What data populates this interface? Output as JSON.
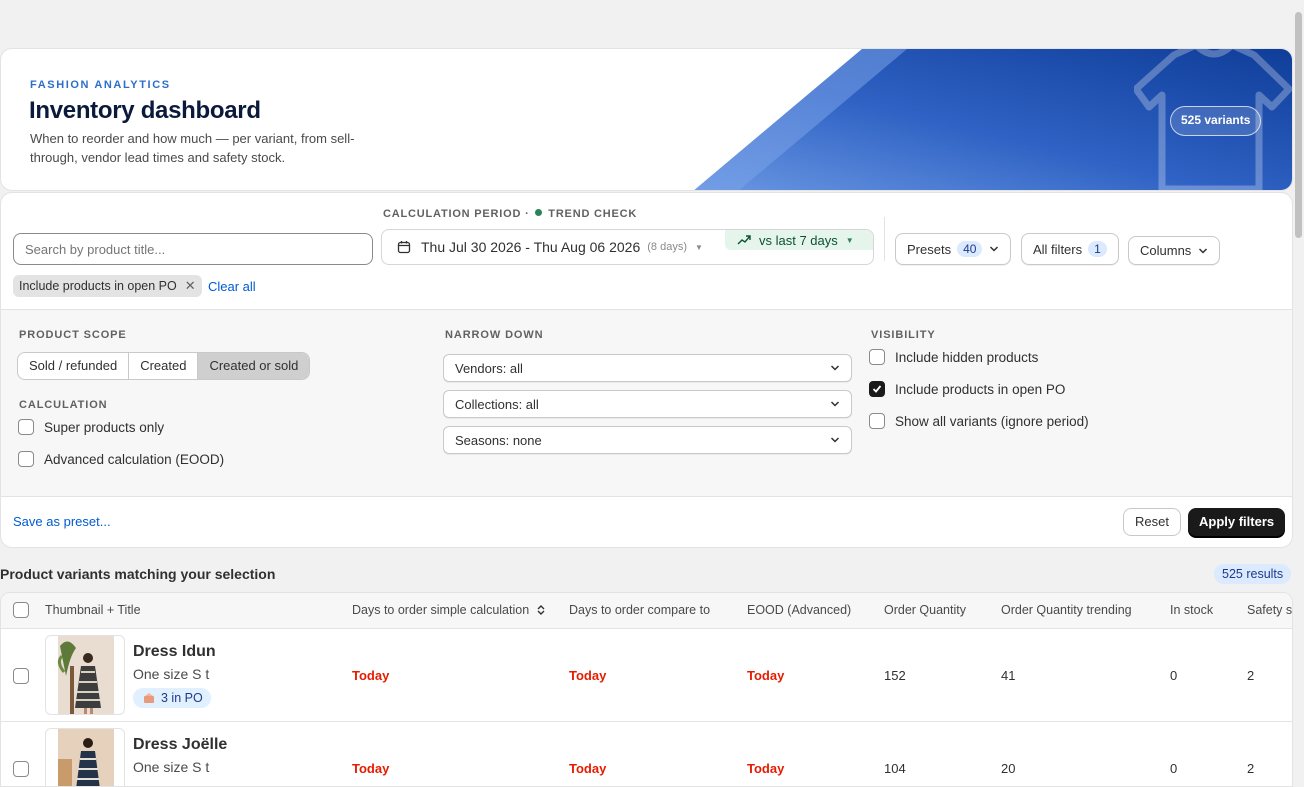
{
  "hero": {
    "eyebrow": "FASHION ANALYTICS",
    "title": "Inventory dashboard",
    "description": "When to reorder and how much — per variant, from sell-through, vendor lead times and safety stock.",
    "variants_pill": "525 variants"
  },
  "toolbar": {
    "search_placeholder": "Search by product title...",
    "period_label": "CALCULATION PERIOD",
    "period_sep": "·",
    "trend_label": "TREND CHECK",
    "date_range": "Thu Jul 30 2026 - Thu Aug 06 2026",
    "date_days": "(8 days)",
    "compare": "vs last 7 days",
    "presets_label": "Presets",
    "presets_count": "40",
    "all_filters_label": "All filters",
    "all_filters_count": "1",
    "columns_label": "Columns"
  },
  "active_filters": {
    "chip": "Include products in open PO",
    "clear_all": "Clear all"
  },
  "panel": {
    "product_scope_label": "PRODUCT SCOPE",
    "scope_options": [
      "Sold / refunded",
      "Created",
      "Created or sold"
    ],
    "scope_selected": "Created or sold",
    "calculation_label": "CALCULATION",
    "calc_options": [
      {
        "label": "Super products only",
        "checked": false
      },
      {
        "label": "Advanced calculation (EOOD)",
        "checked": false
      }
    ],
    "narrow_label": "NARROW DOWN",
    "selects": [
      "Vendors: all",
      "Collections: all",
      "Seasons: none"
    ],
    "visibility_label": "VISIBILITY",
    "visibility_options": [
      {
        "label": "Include hidden products",
        "checked": false
      },
      {
        "label": "Include products in open PO",
        "checked": true
      },
      {
        "label": "Show all variants (ignore period)",
        "checked": false
      }
    ]
  },
  "footer": {
    "save_preset": "Save as preset...",
    "reset": "Reset",
    "apply": "Apply filters"
  },
  "results": {
    "title": "Product variants matching your selection",
    "count": "525 results",
    "columns": [
      "Thumbnail + Title",
      "Days to order simple calculation",
      "Days to order compare to",
      "EOOD (Advanced)",
      "Order Quantity",
      "Order Quantity trending",
      "In stock",
      "Safety s"
    ],
    "rows": [
      {
        "name": "Dress Idun",
        "variant": "One size S t",
        "po": "3 in PO",
        "days_simple": "Today",
        "days_compare": "Today",
        "eood": "Today",
        "order_qty": "152",
        "order_qty_trending": "41",
        "in_stock": "0",
        "safety": "2"
      },
      {
        "name": "Dress Joëlle",
        "variant": "One size S t",
        "po": "",
        "days_simple": "Today",
        "days_compare": "Today",
        "eood": "Today",
        "order_qty": "104",
        "order_qty_trending": "20",
        "in_stock": "0",
        "safety": "2"
      }
    ]
  },
  "colors": {
    "accent": "#2c6ecb",
    "hero_gradient_start": "#5b8ee0",
    "hero_gradient_end": "#0f3d99",
    "danger": "#e51c00",
    "primary_button": "#1a1a1a"
  }
}
